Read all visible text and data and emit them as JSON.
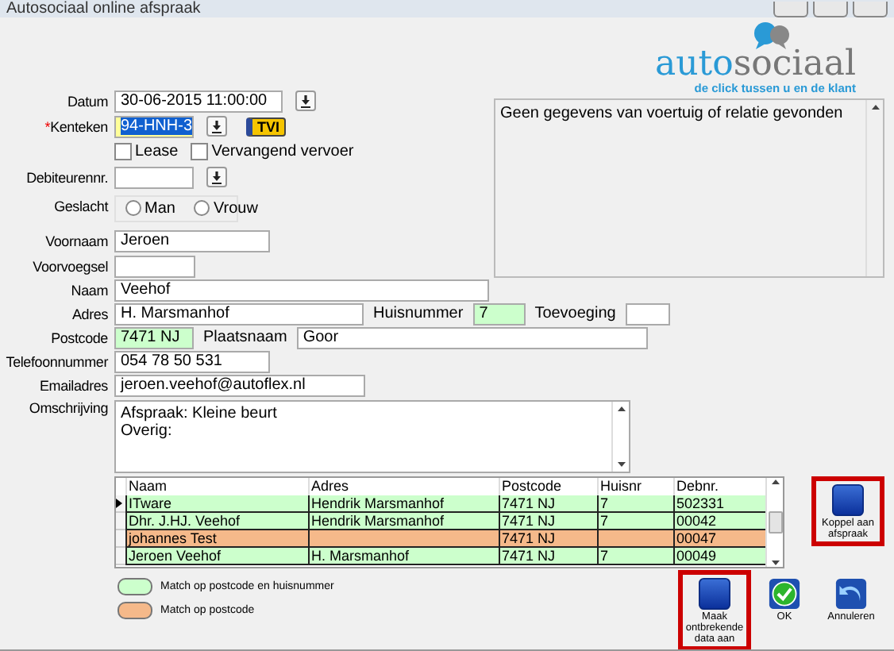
{
  "window": {
    "title": "Autosociaal online afspraak"
  },
  "logo": {
    "brand_a": "auto",
    "brand_b": "sociaal",
    "tagline": "de click tussen u en de klant"
  },
  "info_panel": {
    "text": "Geen gegevens van voertuig of relatie gevonden"
  },
  "datum": {
    "label": "Datum",
    "value": "30-06-2015 11:00:00"
  },
  "kenteken": {
    "label": "Kenteken",
    "required_mark": "*",
    "value": "94-HNH-3",
    "text_selected": true,
    "color": "#ffff99",
    "badge": "TVI"
  },
  "options": [
    {
      "label": "Lease",
      "checked": false
    },
    {
      "label": "Vervangend vervoer",
      "checked": false
    }
  ],
  "debiteurennr": {
    "label": "Debiteurennr."
  },
  "geslacht": {
    "label": "Geslacht",
    "choices": [
      {
        "label": "Man",
        "selected": false
      },
      {
        "label": "Vrouw",
        "selected": false
      }
    ]
  },
  "voornaam": {
    "label": "Voornaam",
    "value": "Jeroen"
  },
  "voorvoegsel": {
    "label": "Voorvoegsel"
  },
  "naam": {
    "label": "Naam",
    "value": "Veehof"
  },
  "adres": {
    "label": "Adres",
    "value": "H. Marsmanhof"
  },
  "huisnummer": {
    "label": "Huisnummer",
    "value": "7",
    "color": "#ccffcc"
  },
  "toevoeging": {
    "label": "Toevoeging"
  },
  "postcode": {
    "label": "Postcode",
    "value": "7471 NJ",
    "color": "#ccffcc"
  },
  "plaatsnaam": {
    "label": "Plaatsnaam",
    "value": "Goor"
  },
  "telefoon": {
    "label": "Telefoonnummer",
    "value": "054 78 50 531"
  },
  "email": {
    "label": "Emailadres",
    "value": "jeroen.veehof@autoflex.nl"
  },
  "omschrijving": {
    "label": "Omschrijving",
    "lines": [
      "Afspraak: Kleine beurt",
      "Overig:"
    ]
  },
  "table": {
    "columns": [
      "Naam",
      "Adres",
      "Postcode",
      "Huisnr",
      "Debnr."
    ],
    "rows": [
      {
        "cells": [
          "ITware",
          "Hendrik Marsmanhof",
          "7471 NJ",
          "7",
          "502331"
        ],
        "color": "#ccffcc",
        "selected": true
      },
      {
        "cells": [
          "Dhr. J.HJ. Veehof",
          "Hendrik Marsmanhof",
          "7471 NJ",
          "7",
          "00042"
        ],
        "color": "#ccffcc",
        "selected": false
      },
      {
        "cells": [
          "johannes Test",
          "",
          "7471 NJ",
          "",
          "00047"
        ],
        "color": "#f5b98a",
        "selected": false
      },
      {
        "cells": [
          "Jeroen Veehof",
          "H. Marsmanhof",
          "7471 NJ",
          "7",
          "00049"
        ],
        "color": "#ccffcc",
        "selected": false
      }
    ]
  },
  "legend": [
    {
      "label": "Match op postcode en huisnummer",
      "color": "#ccffcc"
    },
    {
      "label": "Match op postcode",
      "color": "#f5b98a"
    }
  ],
  "buttons": [
    {
      "kind": "blue",
      "label": "Koppel aan afspraak",
      "highlighted": true
    },
    {
      "kind": "blue",
      "label": "Maak ontbrekende data aan",
      "highlighted": true
    },
    {
      "kind": "ok",
      "label": "OK",
      "highlighted": false
    },
    {
      "kind": "undo",
      "label": "Annuleren",
      "highlighted": false
    }
  ]
}
